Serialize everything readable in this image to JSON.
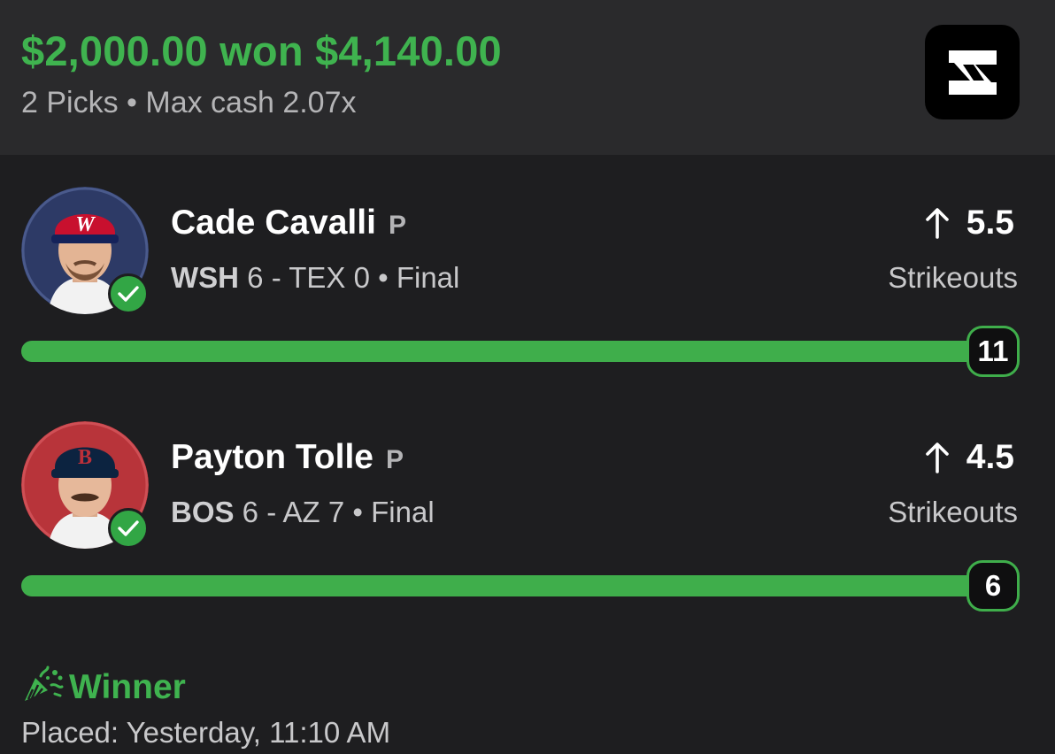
{
  "colors": {
    "accent_green": "#3fb34f",
    "background": "#1e1e20",
    "header_background": "#2a2a2c",
    "wash_red": "#c8102e",
    "wash_navy": "#14225a",
    "bos_red": "#bd3039",
    "bos_navy": "#0c2340"
  },
  "header": {
    "title": "$2,000.00 won $4,140.00",
    "subtitle": "2 Picks • Max cash 2.07x",
    "logo_icon": "app-logo-icon"
  },
  "picks": [
    {
      "player_name": "Cade Cavalli",
      "position": "P",
      "team": "WSH",
      "score_text": " 6 - TEX 0 • Final",
      "direction_icon": "arrow-up-icon",
      "line": "5.5",
      "stat": "Strikeouts",
      "actual": "11",
      "progress": 1.0,
      "status_icon": "check-icon"
    },
    {
      "player_name": "Payton Tolle",
      "position": "P",
      "team": "BOS",
      "score_text": " 6 - AZ 7 • Final",
      "direction_icon": "arrow-up-icon",
      "line": "4.5",
      "stat": "Strikeouts",
      "actual": "6",
      "progress": 1.0,
      "status_icon": "check-icon"
    }
  ],
  "result": {
    "icon": "party-popper-icon",
    "label": "Winner",
    "placed": "Placed: Yesterday, 11:10 AM"
  }
}
